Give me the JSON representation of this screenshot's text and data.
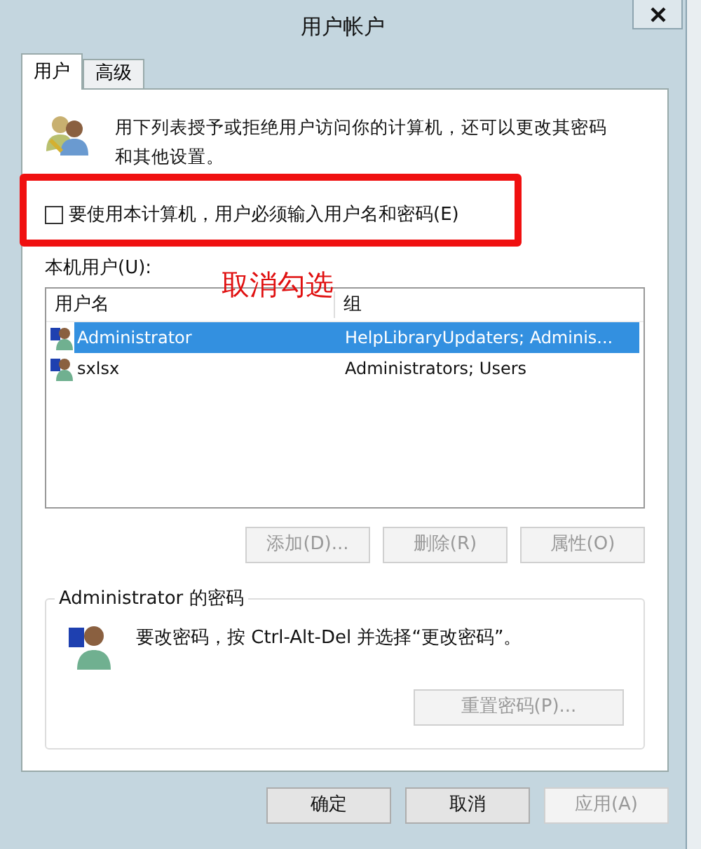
{
  "window": {
    "title": "用户帐户"
  },
  "tabs": [
    {
      "label": "用户",
      "selected": true
    },
    {
      "label": "高级",
      "selected": false
    }
  ],
  "intro": "用下列表授予或拒绝用户访问你的计算机，还可以更改其密码和其他设置。",
  "require_password": {
    "label": "要使用本计算机，用户必须输入用户名和密码(E)",
    "checked": false
  },
  "annotation": "取消勾选",
  "users_label": "本机用户(U):",
  "table": {
    "columns": [
      "用户名",
      "组"
    ],
    "rows": [
      {
        "cells": [
          "Administrator",
          "HelpLibraryUpdaters; Adminis..."
        ],
        "selected": true
      },
      {
        "cells": [
          "sxlsx",
          "Administrators; Users"
        ],
        "selected": false
      }
    ]
  },
  "user_buttons": [
    {
      "label": "添加(D)...",
      "disabled": true
    },
    {
      "label": "删除(R)",
      "disabled": true
    },
    {
      "label": "属性(O)",
      "disabled": true
    }
  ],
  "password_group": {
    "title": "Administrator 的密码",
    "text": "要改密码，按 Ctrl-Alt-Del 并选择“更改密码”。",
    "button": {
      "label": "重置密码(P)...",
      "disabled": true
    }
  },
  "buttons": [
    {
      "label": "确定",
      "disabled": false
    },
    {
      "label": "取消",
      "disabled": false
    },
    {
      "label": "应用(A)",
      "disabled": true
    }
  ]
}
